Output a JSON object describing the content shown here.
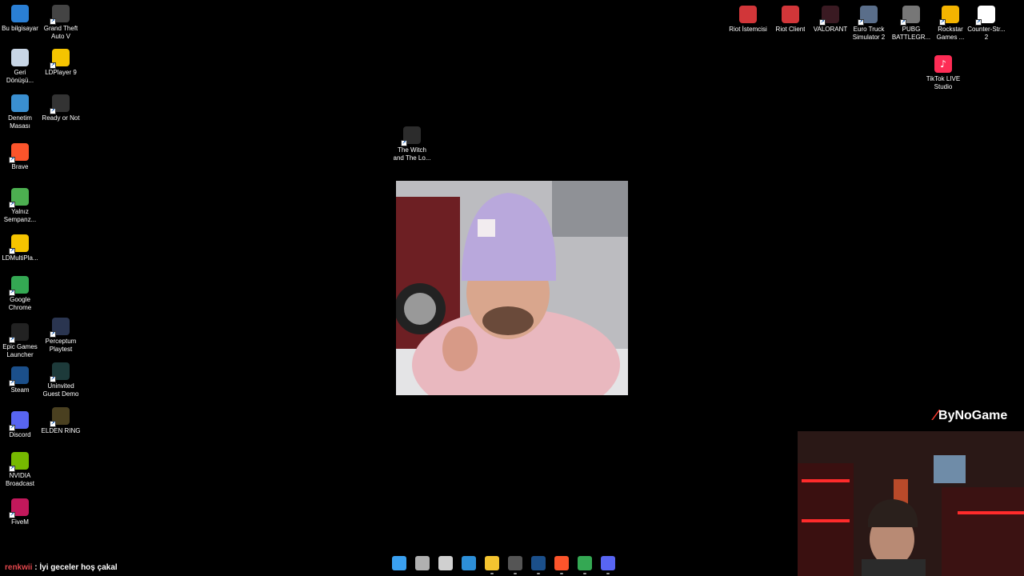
{
  "desktop": {
    "left_column": [
      {
        "label": "Bu bilgisayar",
        "icon": "computer-icon",
        "color": "#2a7fd4"
      },
      {
        "label": "Geri\nDönüşü...",
        "icon": "recycle-bin-icon",
        "color": "#c8d6e6"
      },
      {
        "label": "Denetim\nMasası",
        "icon": "control-panel-icon",
        "color": "#3a8fd0"
      },
      {
        "label": "Brave",
        "icon": "brave-icon",
        "color": "#fb542b"
      },
      {
        "label": "Yalnız\nSempanz...",
        "icon": "chrome-icon",
        "color": "#4caf50"
      },
      {
        "label": "LDMultiPla...",
        "icon": "ldmultiplayer-icon",
        "color": "#f5c400"
      },
      {
        "label": "Google\nChrome",
        "icon": "chrome-icon",
        "color": "#34a853"
      },
      {
        "label": "Epic Games\nLauncher",
        "icon": "epic-games-icon",
        "color": "#222222"
      },
      {
        "label": "Steam",
        "icon": "steam-icon",
        "color": "#1b4f8a"
      },
      {
        "label": "Discord",
        "icon": "discord-icon",
        "color": "#5865f2"
      },
      {
        "label": "NVIDIA\nBroadcast",
        "icon": "nvidia-icon",
        "color": "#76b900"
      },
      {
        "label": "FiveM",
        "icon": "fivem-icon",
        "color": "#c2185b"
      }
    ],
    "second_column": [
      {
        "label": "Grand Theft\nAuto V",
        "icon": "gta-icon",
        "color": "#444444"
      },
      {
        "label": "LDPlayer 9",
        "icon": "ldplayer-icon",
        "color": "#f5c400"
      },
      {
        "label": "Ready or Not",
        "icon": "ready-or-not-icon",
        "color": "#333333"
      },
      {
        "label": "Perceptum\nPlaytest",
        "icon": "perceptum-icon",
        "color": "#2a3550"
      },
      {
        "label": "Uninvited\nGuest Demo",
        "icon": "uninvited-guest-icon",
        "color": "#1d3a3a"
      },
      {
        "label": "ELDEN RING",
        "icon": "elden-ring-icon",
        "color": "#4a4020"
      }
    ],
    "center_icon": {
      "label": "The Witch\nand The Lo...",
      "icon": "witch-game-icon",
      "color": "#2c2c2c"
    },
    "top_right": [
      {
        "label": "Riot İstemcisi",
        "icon": "riot-icon",
        "color": "#d13639"
      },
      {
        "label": "Riot Client",
        "icon": "riot-icon",
        "color": "#d13639"
      },
      {
        "label": "VALORANT",
        "icon": "valorant-icon",
        "color": "#3a1a22"
      },
      {
        "label": "Euro Truck\nSimulator 2",
        "icon": "euro-truck-icon",
        "color": "#5a6e8a"
      },
      {
        "label": "PUBG\nBATTLEGR...",
        "icon": "pubg-icon",
        "color": "#777777"
      },
      {
        "label": "Rockstar\nGames ...",
        "icon": "rockstar-icon",
        "color": "#f4b400"
      },
      {
        "label": "Counter-Str...\n2",
        "icon": "file-icon",
        "color": "#ffffff"
      }
    ],
    "tiktok": {
      "label": "TikTok LIVE\nStudio",
      "icon": "tiktok-live-icon",
      "color": "#fe2c55"
    }
  },
  "overlay": {
    "brand": "ByNoGame",
    "chat_user": "renkwii",
    "chat_separator": ":",
    "chat_message": "İyi geceler hoş çakal"
  },
  "taskbar": [
    {
      "icon": "windows-start-icon",
      "color": "#3aa0f0"
    },
    {
      "icon": "task-view-icon",
      "color": "#b0b0b0"
    },
    {
      "icon": "snipping-tool-icon",
      "color": "#d0d0d0"
    },
    {
      "icon": "photos-icon",
      "color": "#2d8fd8"
    },
    {
      "icon": "file-explorer-icon",
      "color": "#f4c430"
    },
    {
      "icon": "obs-icon",
      "color": "#555555"
    },
    {
      "icon": "steam-icon",
      "color": "#1b4f8a"
    },
    {
      "icon": "brave-icon",
      "color": "#fb542b"
    },
    {
      "icon": "chrome-icon",
      "color": "#34a853"
    },
    {
      "icon": "discord-icon",
      "color": "#5865f2"
    }
  ]
}
